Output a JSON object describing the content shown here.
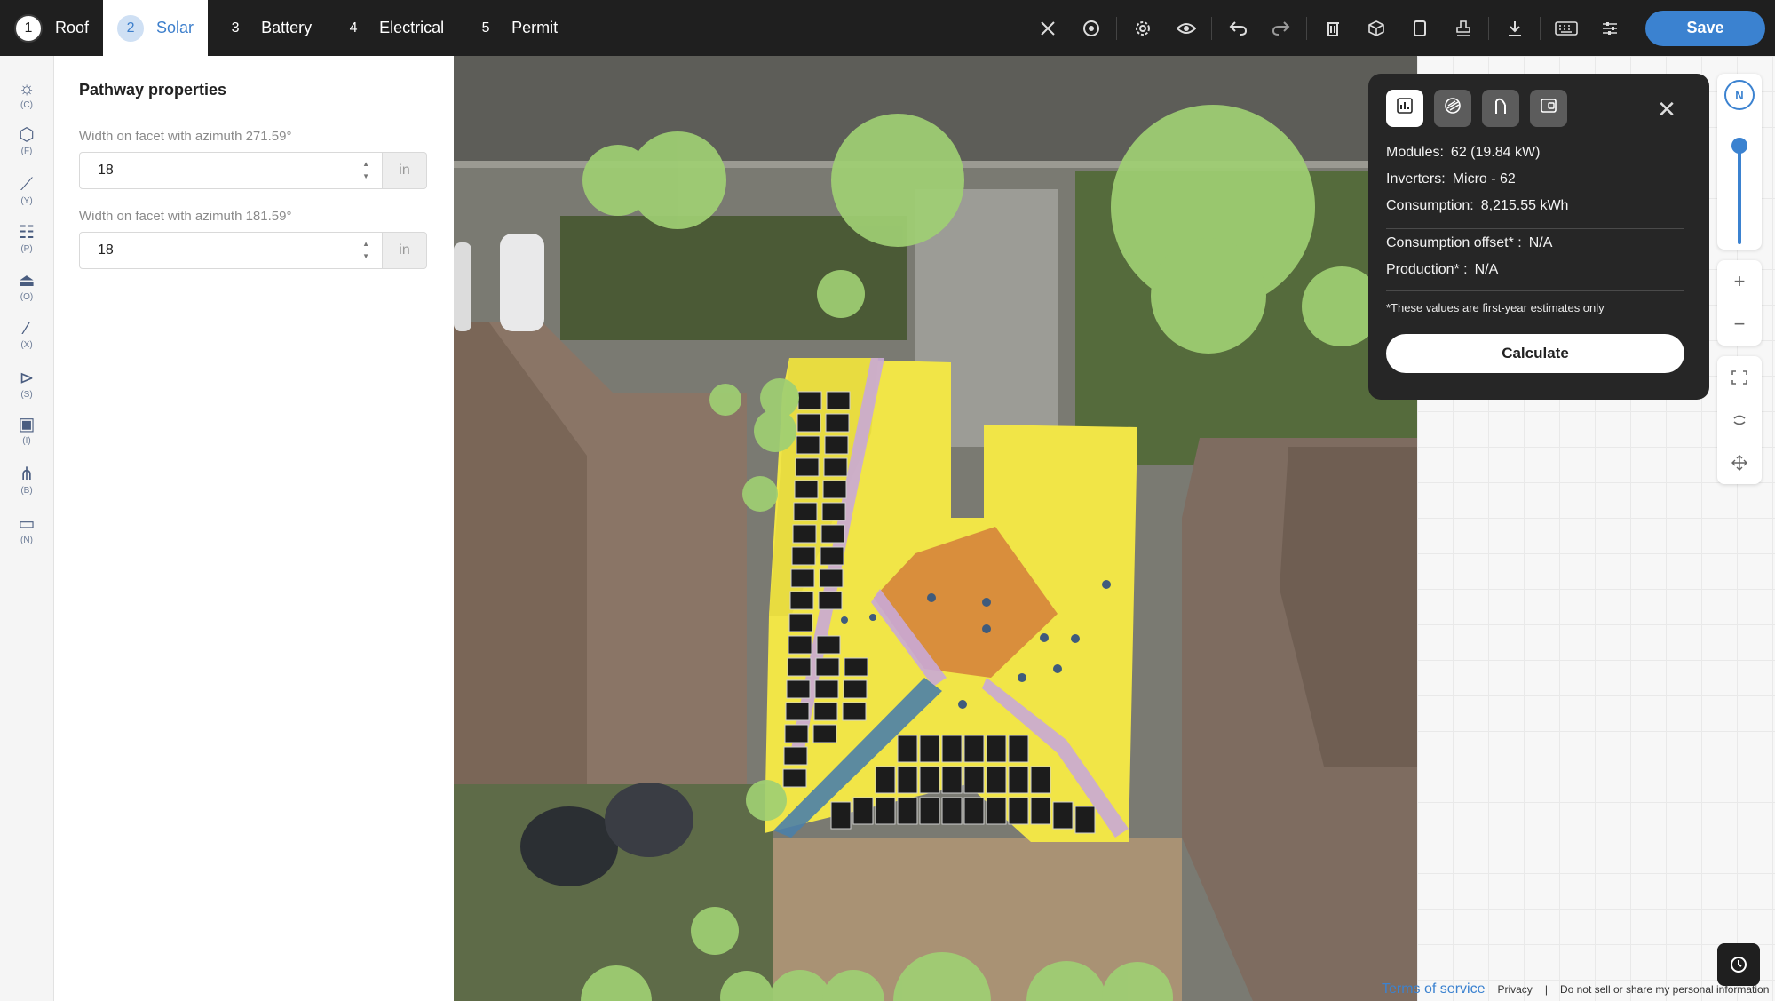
{
  "steps": [
    {
      "num": "1",
      "label": "Roof"
    },
    {
      "num": "2",
      "label": "Solar"
    },
    {
      "num": "3",
      "label": "Battery"
    },
    {
      "num": "4",
      "label": "Electrical"
    },
    {
      "num": "5",
      "label": "Permit"
    }
  ],
  "active_step": "Solar",
  "toolbar": {
    "icons": [
      "tools-icon",
      "target-icon",
      "settings-icon",
      "eye-icon",
      "undo-icon",
      "redo-icon",
      "trash-icon",
      "cube-icon",
      "page-icon",
      "stamp-icon",
      "download-icon",
      "keyboard-icon",
      "sliders-icon"
    ],
    "save_label": "Save"
  },
  "rail": [
    {
      "icon": "sun-icon",
      "key": "(C)"
    },
    {
      "icon": "facet-icon",
      "key": "(F)"
    },
    {
      "icon": "line-icon",
      "key": "(Y)"
    },
    {
      "icon": "panel-icon",
      "key": "(P)"
    },
    {
      "icon": "obstruction-icon",
      "key": "(O)"
    },
    {
      "icon": "magic-wand-icon",
      "key": "(X)"
    },
    {
      "icon": "select-icon",
      "key": "(S)"
    },
    {
      "icon": "image-icon",
      "key": "(I)"
    },
    {
      "icon": "string-icon",
      "key": "(B)"
    },
    {
      "icon": "ruler-icon",
      "key": "(N)"
    }
  ],
  "properties": {
    "title": "Pathway properties",
    "fields": [
      {
        "label": "Width on facet with azimuth 271.59°",
        "value": "18",
        "unit": "in"
      },
      {
        "label": "Width on facet with azimuth 181.59°",
        "value": "18",
        "unit": "in"
      }
    ]
  },
  "stats": {
    "modules_label": "Modules:",
    "modules_value": "62 (19.84 kW)",
    "inverters_label": "Inverters:",
    "inverters_value": "Micro - 62",
    "consumption_label": "Consumption:",
    "consumption_value": "8,215.55 kWh",
    "offset_label": "Consumption offset* :",
    "offset_value": "N/A",
    "production_label": "Production* :",
    "production_value": "N/A",
    "note": "*These values are first-year estimates only",
    "calculate_label": "Calculate"
  },
  "compass_label": "N",
  "footer": {
    "terms": "Terms of service",
    "privacy": "Privacy",
    "separator": "|",
    "do_not_sell": "Do not sell or share my personal information"
  }
}
